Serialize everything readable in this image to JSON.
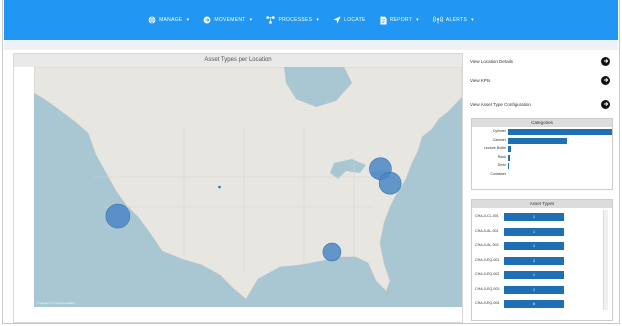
{
  "nav": {
    "items": [
      {
        "label": "MANAGE",
        "icon": "globe-icon"
      },
      {
        "label": "MOVEMENT",
        "icon": "arrow-circle-icon"
      },
      {
        "label": "PROCESSES",
        "icon": "nodes-icon"
      },
      {
        "label": "LOCATE",
        "icon": "location-arrow-icon"
      },
      {
        "label": "REPORT",
        "icon": "document-icon"
      },
      {
        "label": "ALERTS",
        "icon": "signal-icon"
      }
    ]
  },
  "map": {
    "title": "Asset Types per Location",
    "credit": "© Mapbox © OpenStreetMap",
    "bubbles": [
      {
        "lon": -118.3,
        "lat": 34.4,
        "r": 12
      },
      {
        "lon": -72.3,
        "lat": 41.9,
        "r": 11
      },
      {
        "lon": -70.6,
        "lat": 39.6,
        "r": 11
      },
      {
        "lon": -80.8,
        "lat": 28.7,
        "r": 9
      }
    ],
    "dot": {
      "lon": -100.5,
      "lat": 39.0
    }
  },
  "links": [
    {
      "label": "View Location Details"
    },
    {
      "label": "View KPIs"
    },
    {
      "label": "View Asset Type Configuration"
    }
  ],
  "chart_data": [
    {
      "type": "bar",
      "title": "Categories",
      "orientation": "horizontal",
      "categories": [
        "Cylinder",
        "Canister",
        "Lecture Bottle",
        "Rack",
        "Dewr",
        "Container"
      ],
      "values": [
        100,
        57,
        3,
        2,
        1,
        0
      ],
      "colors": {
        "bar": "#1f6fb4"
      }
    },
    {
      "type": "table",
      "title": "Asset Types",
      "rows": [
        {
          "label": "CHA-0-CL-001",
          "value": "1"
        },
        {
          "label": "CHA-0-AL-001",
          "value": "1"
        },
        {
          "label": "CHA-0-AL-002",
          "value": "1"
        },
        {
          "label": "CHA-0-EQ-001",
          "value": "2"
        },
        {
          "label": "CHA-0-EQ-002",
          "value": "1"
        },
        {
          "label": "CHA-0-EQ-003",
          "value": "1"
        },
        {
          "label": "CHA-0-EQ-004",
          "value": "6"
        }
      ]
    }
  ],
  "colors": {
    "nav": "#2196f3",
    "accent": "#1f6fb4",
    "bubble": "#4a86c5"
  }
}
